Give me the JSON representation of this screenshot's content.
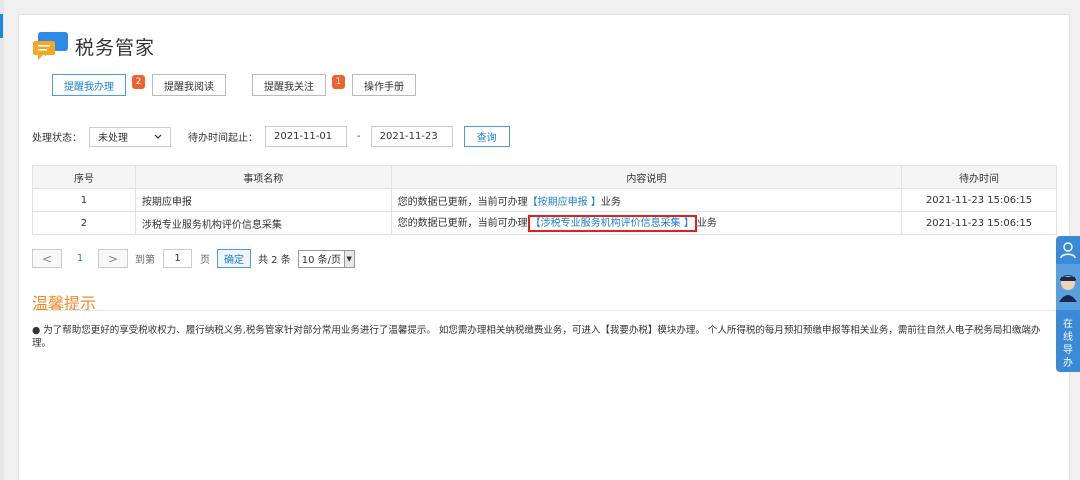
{
  "header": {
    "title": "税务管家"
  },
  "tabs": [
    {
      "label": "提醒我办理",
      "badge": "2",
      "active": true
    },
    {
      "label": "提醒我阅读",
      "badge": ""
    },
    {
      "label": "提醒我关注",
      "badge": "1"
    },
    {
      "label": "操作手册",
      "badge": ""
    }
  ],
  "filter": {
    "status_label": "处理状态：",
    "status_value": "未处理",
    "date_label": "待办时间起止：",
    "date_start": "2021-11-01",
    "date_sep": "-",
    "date_end": "2021-11-23",
    "query_label": "查询"
  },
  "table": {
    "headers": [
      "序号",
      "事项名称",
      "内容说明",
      "待办时间"
    ],
    "rows": [
      {
        "no": "1",
        "name": "按期应申报",
        "desc_prefix": "您的数据已更新，当前可办理",
        "desc_link": "【按期应申报 】",
        "desc_suffix": "业务",
        "time": "2021-11-23 15:06:15"
      },
      {
        "no": "2",
        "name": "涉税专业服务机构评价信息采集",
        "desc_prefix": "您的数据已更新，当前可办理",
        "desc_link": "【涉税专业服务机构评价信息采集 】",
        "desc_suffix": "业务",
        "time": "2021-11-23 15:06:15"
      }
    ]
  },
  "pager": {
    "prev": "<",
    "page": "1",
    "next": ">",
    "goto_label": "到第",
    "goto_value": "1",
    "page_unit": "页",
    "confirm": "确定",
    "total": "共 2 条",
    "page_size": "10 条/页"
  },
  "tips": {
    "title": "温馨提示",
    "text": "● 为了帮助您更好的享受税收权力、履行纳税义务,税务管家针对部分常用业务进行了温馨提示。 如您需办理相关纳税缴费业务，可进入【我要办税】模块办理。 个人所得税的每月预扣预缴申报等相关业务，需前往自然人电子税务局扣缴端办理。"
  },
  "help": {
    "text": "在线导办"
  },
  "colors": {
    "accent": "#1a7fd4",
    "badge": "#f0622d",
    "highlight": "#e02020",
    "tips": "#f08a2a"
  }
}
